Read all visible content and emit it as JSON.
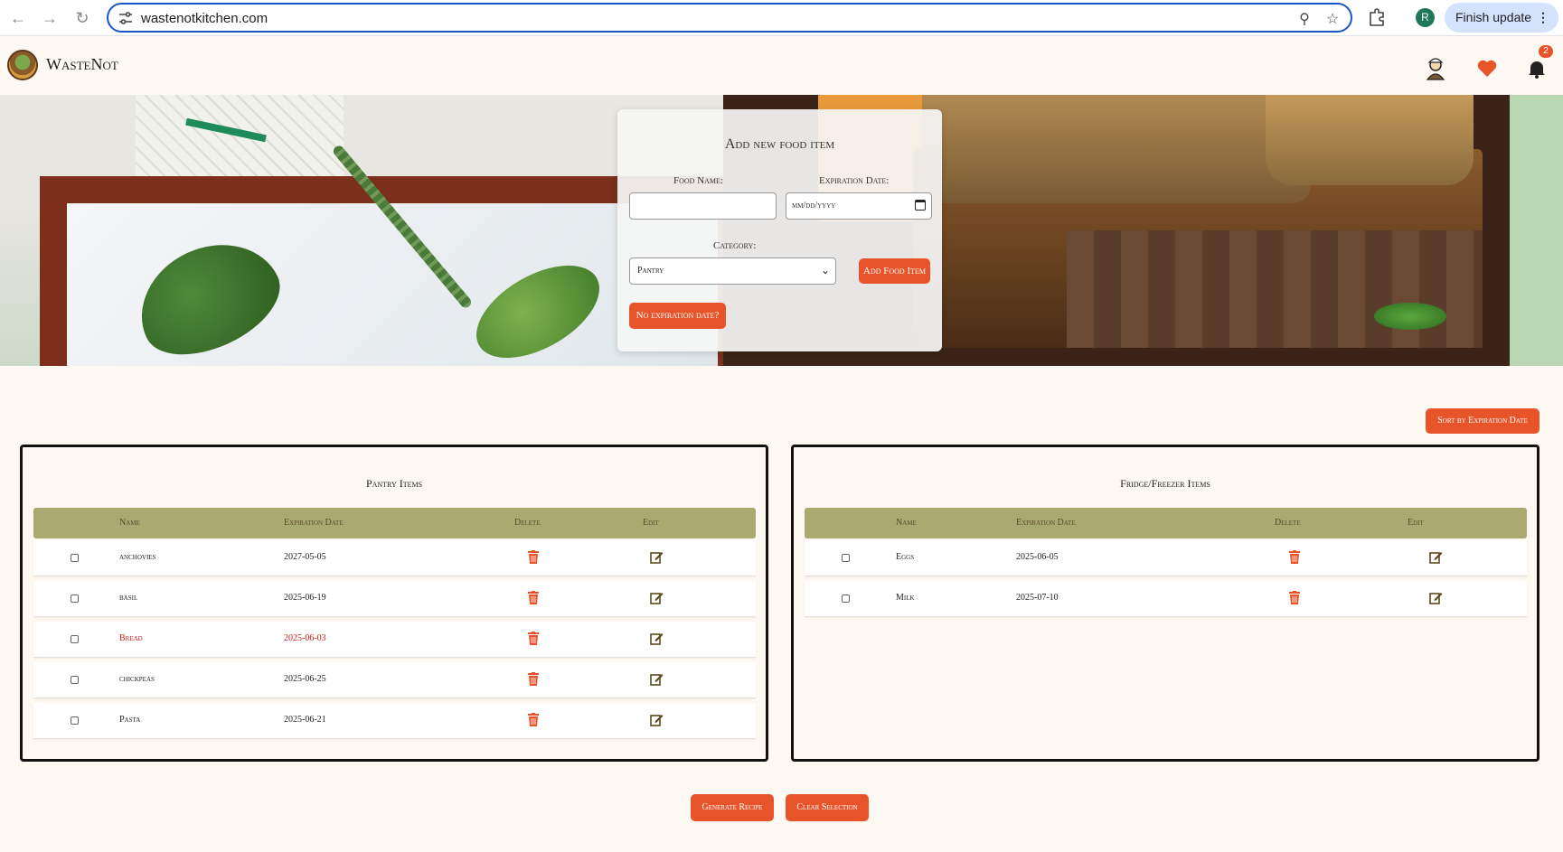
{
  "browser": {
    "url": "wastenotkitchen.com",
    "finish_update_label": "Finish update",
    "profile_initial": "R"
  },
  "app": {
    "brand": "WasteNot",
    "notification_count": "2"
  },
  "form": {
    "title": "Add new food item",
    "food_name_label": "Food Name:",
    "food_name_value": "",
    "expiration_label": "Expiration Date:",
    "expiration_placeholder": "mm/dd/yyyy",
    "category_label": "Category:",
    "category_value": "Pantry",
    "add_button": "Add Food Item",
    "no_expiration_button": "No expiration date?"
  },
  "sort_button": "Sort by Expiration Date",
  "pantry": {
    "title": "Pantry Items",
    "headers": [
      "Name",
      "Expiration Date",
      "Delete",
      "Edit"
    ],
    "rows": [
      {
        "name": "anchovies",
        "date": "2027-05-05",
        "expired": false
      },
      {
        "name": "basil",
        "date": "2025-06-19",
        "expired": false
      },
      {
        "name": "Bread",
        "date": "2025-06-03",
        "expired": true
      },
      {
        "name": "chickpeas",
        "date": "2025-06-25",
        "expired": false
      },
      {
        "name": "Pasta",
        "date": "2025-06-21",
        "expired": false
      }
    ]
  },
  "fridge": {
    "title": "Fridge/Freezer Items",
    "headers": [
      "Name",
      "Expiration Date",
      "Delete",
      "Edit"
    ],
    "rows": [
      {
        "name": "Eggs",
        "date": "2025-06-05",
        "expired": false
      },
      {
        "name": "Milk",
        "date": "2025-07-10",
        "expired": false
      }
    ]
  },
  "actions": {
    "generate": "Generate Recipe",
    "clear": "Clear Selection"
  },
  "colors": {
    "accent": "#e8542a",
    "table_header": "#aaa96f",
    "expired": "#d11a1a",
    "page_bg": "#fdf8f1"
  }
}
